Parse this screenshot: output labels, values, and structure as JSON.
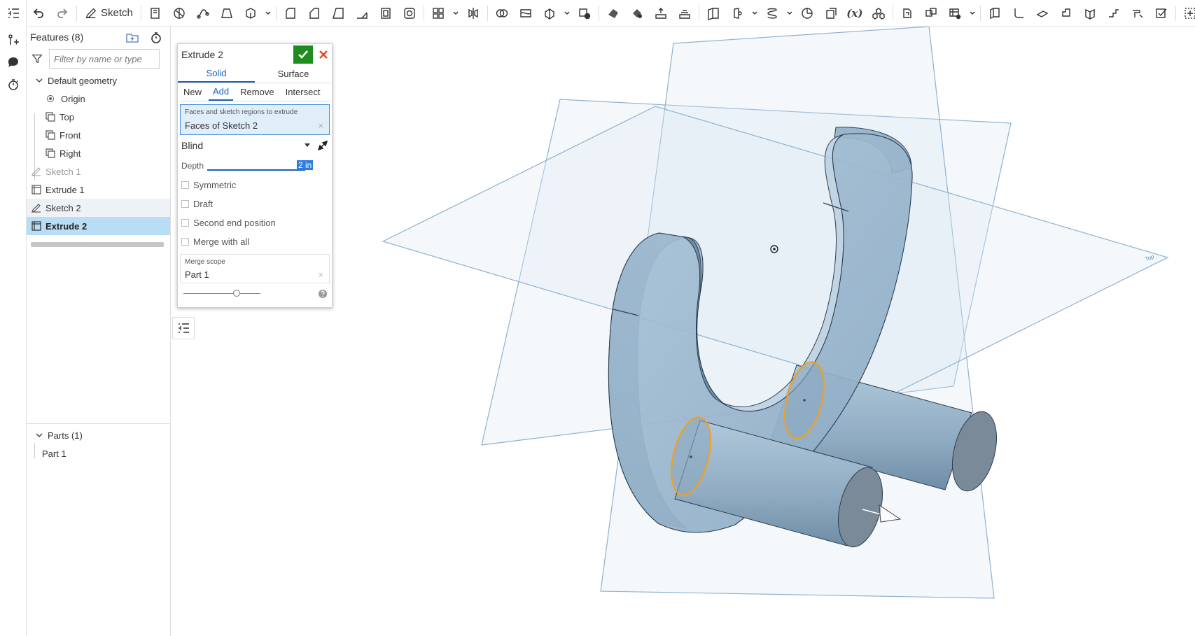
{
  "toolbar": {
    "sketch_label": "Sketch",
    "fx_label": "(x)"
  },
  "features_panel": {
    "title": "Features (8)",
    "filter_placeholder": "Filter by name or type",
    "default_geometry_label": "Default geometry",
    "items": {
      "origin": "Origin",
      "top": "Top",
      "front": "Front",
      "right": "Right",
      "sketch1": "Sketch 1",
      "extrude1": "Extrude 1",
      "sketch2": "Sketch 2",
      "extrude2": "Extrude 2"
    },
    "parts_label": "Parts (1)",
    "part1": "Part 1"
  },
  "dialog": {
    "title": "Extrude 2",
    "tab_solid": "Solid",
    "tab_surface": "Surface",
    "op_new": "New",
    "op_add": "Add",
    "op_remove": "Remove",
    "op_intersect": "Intersect",
    "selection_label": "Faces and sketch regions to extrude",
    "selection_value": "Faces of Sketch 2",
    "end_type": "Blind",
    "depth_label": "Depth",
    "depth_value": "2 in",
    "symmetric": "Symmetric",
    "draft": "Draft",
    "second_end": "Second end position",
    "merge_all": "Merge with all",
    "merge_scope_label": "Merge scope",
    "merge_scope_value": "Part 1",
    "clear_symbol": "×"
  },
  "viewport": {
    "plane_label": "Top"
  },
  "colors": {
    "accent_blue": "#1c5fb8",
    "selection_bg": "#b8ddf5",
    "ok_green": "#1e8c1e",
    "cancel_red": "#e24a2a",
    "highlight_orange": "#f0a020",
    "part_fill": "#9fbcd2"
  }
}
